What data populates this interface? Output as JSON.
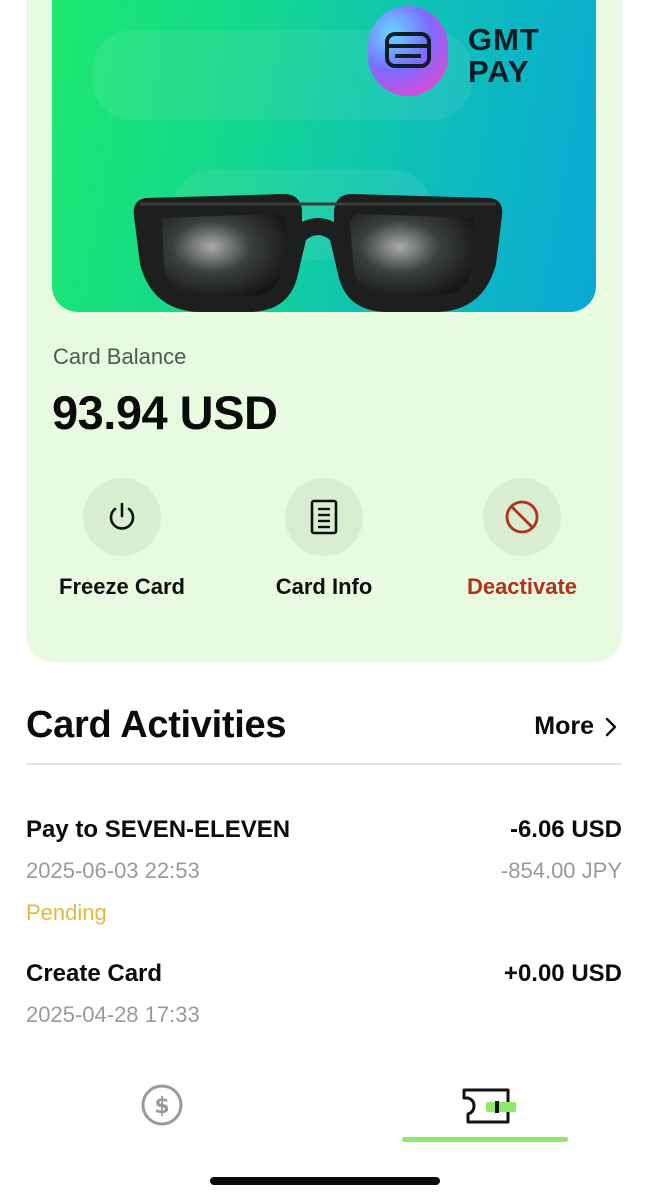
{
  "card": {
    "brand_line1": "GMT",
    "brand_line2": "PAY",
    "colors": {
      "gradient_start": "#1ee870",
      "gradient_end": "#0aa8d6"
    }
  },
  "balance": {
    "label": "Card Balance",
    "amount": "93.94 USD"
  },
  "actions": [
    {
      "label": "Freeze Card",
      "icon": "power-icon"
    },
    {
      "label": "Card Info",
      "icon": "document-icon"
    },
    {
      "label": "Deactivate",
      "icon": "block-icon",
      "color": "#b0311c"
    }
  ],
  "activities": {
    "title": "Card Activities",
    "more_label": "More",
    "items": [
      {
        "name": "Pay to SEVEN-ELEVEN",
        "amount": "-6.06 USD",
        "date": "2025-06-03 22:53",
        "secondary_amount": "-854.00 JPY",
        "status": "Pending"
      },
      {
        "name": "Create Card",
        "amount": "+0.00 USD",
        "date": "2025-04-28 17:33"
      }
    ]
  },
  "tabbar": {
    "tabs": [
      {
        "icon": "dollar-icon",
        "active": false
      },
      {
        "icon": "card-icon",
        "active": true
      }
    ],
    "active_color": "#8ee86a"
  }
}
